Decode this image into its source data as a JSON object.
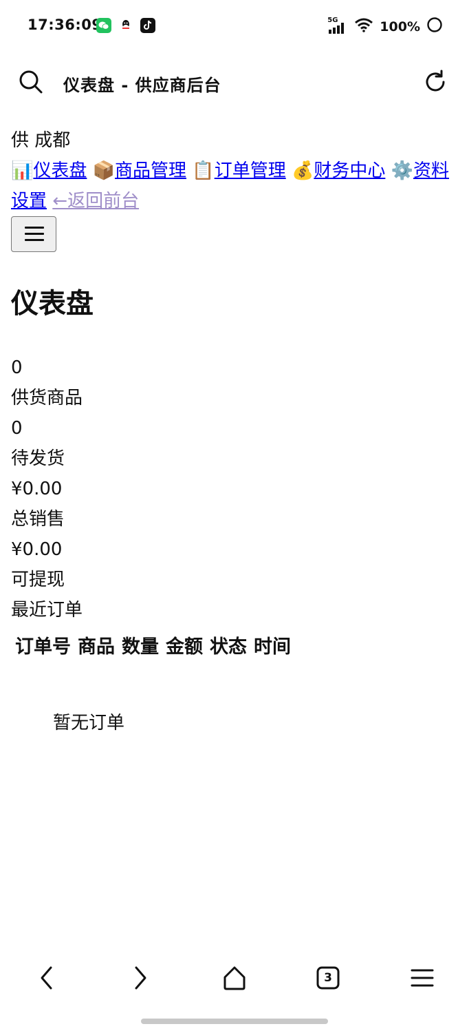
{
  "status_bar": {
    "time": "17:36:09",
    "network": "5G",
    "battery": "100%"
  },
  "browser": {
    "title": "仪表盘 - 供应商后台",
    "tab_count": "3"
  },
  "sidebar": {
    "brand": "供 成都",
    "nav": [
      {
        "icon": "📊",
        "label": "仪表盘"
      },
      {
        "icon": "📦",
        "label": "商品管理"
      },
      {
        "icon": "📋",
        "label": "订单管理"
      },
      {
        "icon": "💰",
        "label": "财务中心"
      },
      {
        "icon": "⚙️",
        "label": "资料设置"
      }
    ],
    "back_link": "←返回前台"
  },
  "main": {
    "title": "仪表盘",
    "stats": [
      {
        "value": "0",
        "label": "供货商品"
      },
      {
        "value": "0",
        "label": "待发货"
      },
      {
        "value": "¥0.00",
        "label": "总销售"
      },
      {
        "value": "¥0.00",
        "label": "可提现"
      }
    ],
    "recent_orders": {
      "heading": "最近订单",
      "columns": [
        "订单号",
        "商品",
        "数量",
        "金额",
        "状态",
        "时间"
      ],
      "empty_text": "暂无订单"
    }
  },
  "colors": {
    "link": "#0000ee",
    "visited_link": "#9f8ec9",
    "wechat": "#21c25e"
  }
}
